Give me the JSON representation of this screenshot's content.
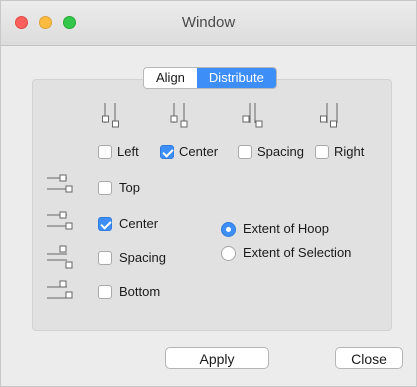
{
  "window": {
    "title": "Window"
  },
  "tabs": [
    {
      "label": "Align",
      "active": false
    },
    {
      "label": "Distribute",
      "active": true
    }
  ],
  "horizontal": {
    "left": {
      "label": "Left",
      "checked": false
    },
    "center": {
      "label": "Center",
      "checked": true
    },
    "spacing": {
      "label": "Spacing",
      "checked": false
    },
    "right": {
      "label": "Right",
      "checked": false
    }
  },
  "vertical": {
    "top": {
      "label": "Top",
      "checked": false
    },
    "center": {
      "label": "Center",
      "checked": true
    },
    "spacing": {
      "label": "Spacing",
      "checked": false
    },
    "bottom": {
      "label": "Bottom",
      "checked": false
    }
  },
  "extent": {
    "hoop": {
      "label": "Extent of Hoop",
      "selected": true
    },
    "selection": {
      "label": "Extent of Selection",
      "selected": false
    }
  },
  "buttons": {
    "apply": "Apply",
    "close": "Close"
  },
  "colors": {
    "accent": "#3d8ef7",
    "panel": "#e1e1e1",
    "window": "#ececec"
  }
}
